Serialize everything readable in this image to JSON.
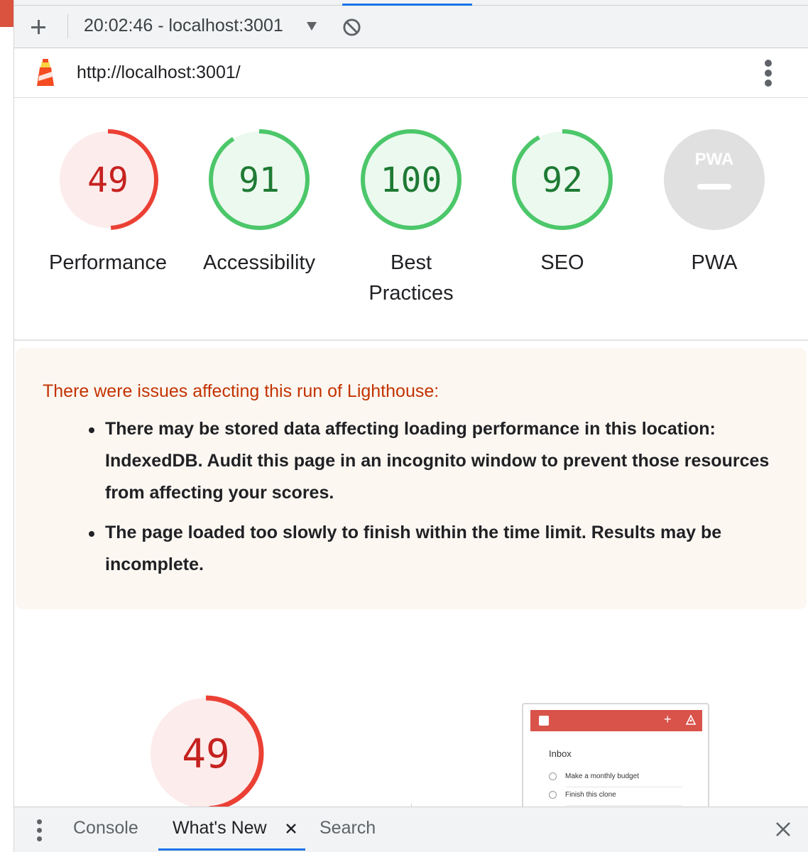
{
  "toolbar": {
    "new_report_label": "+",
    "report_select": "20:02:46 - localhost:3001"
  },
  "urlbar": {
    "url": "http://localhost:3001/"
  },
  "categories": [
    {
      "label": "Performance",
      "score": "49",
      "score_value": 49,
      "status": "fail",
      "color": "#eb4034"
    },
    {
      "label": "Accessibility",
      "score": "91",
      "score_value": 91,
      "status": "pass",
      "color": "#0cce6b"
    },
    {
      "label_line1": "Best",
      "label_line2": "Practices",
      "score": "100",
      "score_value": 100,
      "status": "pass",
      "color": "#0cce6b"
    },
    {
      "label": "SEO",
      "score": "92",
      "score_value": 92,
      "status": "pass",
      "color": "#0cce6b"
    },
    {
      "label": "PWA",
      "badge": "PWA",
      "status": "not-applicable"
    }
  ],
  "colors": {
    "fail": "#eb4034",
    "fail_bg": "#fdecec",
    "fail_text": "#c5221f",
    "pass": "#4cc76a",
    "pass_bg": "#ecf9ef",
    "pass_text": "#1e7a34",
    "na_bg": "#e0e0e0",
    "warning_title": "#c33300",
    "accent": "#1a73e8"
  },
  "warning": {
    "title": "There were issues affecting this run of Lighthouse:",
    "items": [
      "There may be stored data affecting loading performance in this location: IndexedDB. Audit this page in an incognito window to prevent those resources from affecting your scores.",
      "The page loaded too slowly to finish within the time limit. Results may be incomplete."
    ]
  },
  "performance_section": {
    "score": "49",
    "score_value": 49
  },
  "screenshot_thumbnail": {
    "title": "Inbox",
    "tasks": [
      "Make a monthly budget",
      "Finish this clone"
    ]
  },
  "drawer": {
    "tabs": [
      {
        "label": "Console",
        "active": false
      },
      {
        "label": "What's New",
        "active": true
      },
      {
        "label": "Search",
        "active": false
      }
    ]
  }
}
